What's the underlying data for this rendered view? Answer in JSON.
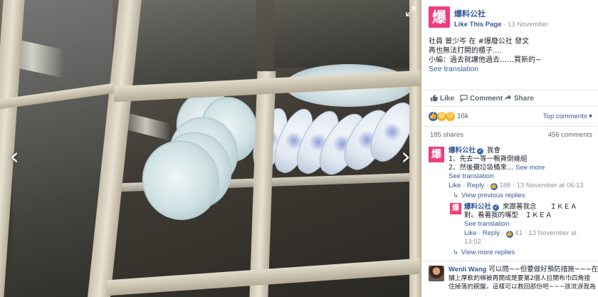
{
  "post": {
    "page_name": "爆料公社",
    "logo_char": "爆",
    "like_page": "Like This Page",
    "date": "13 November",
    "text_lines": [
      "社員 曾少岑 在 #爆廢公社 發文",
      "再也無法打開的櫃子....",
      "小編：過去就讓他過去……買新的~"
    ],
    "see_translation": "See translation"
  },
  "actions": {
    "like": "Like",
    "comment": "Comment",
    "share": "Share"
  },
  "reactions": {
    "count": "16k",
    "top_comments": "Top comments",
    "colors": {
      "like": "#4267b2",
      "haha": "#f7b125",
      "wow": "#f7b125"
    }
  },
  "stats": {
    "shares": "185 shares",
    "comments": "456 comments"
  },
  "comments": [
    {
      "author": "爆料公社",
      "lines": [
        "我會",
        "1、先去一等一鴨貨倒幾組",
        "2、然後攤垃圾桶來..."
      ],
      "see_more": "See more",
      "see_translation": "See translation",
      "like": "Like",
      "reply": "Reply",
      "likes": "188",
      "time": "13 November at 06:13",
      "view_previous": "View previous replies"
    }
  ],
  "reply": {
    "author": "爆料公社",
    "lines": [
      "來跟著我念　　ＩＫＥＡ",
      "對。看著我的嘴型　ＩＫＥＡ"
    ],
    "see_translation": "See translation",
    "like": "Like",
    "reply": "Reply",
    "likes": "41",
    "time_line1": "13 November at",
    "time_line2": "13:02",
    "view_more": "View more replies"
  },
  "wenli": {
    "author": "Wenli Wang",
    "lines": [
      "可以問~~但要做好預防措施~~~在地上",
      "舖上厚軟的棉被再開成是要第2個人拉開布巾四角接",
      "住掉落的碗盤，這樣可以救回部份吧~~~孩流淚我為"
    ]
  }
}
